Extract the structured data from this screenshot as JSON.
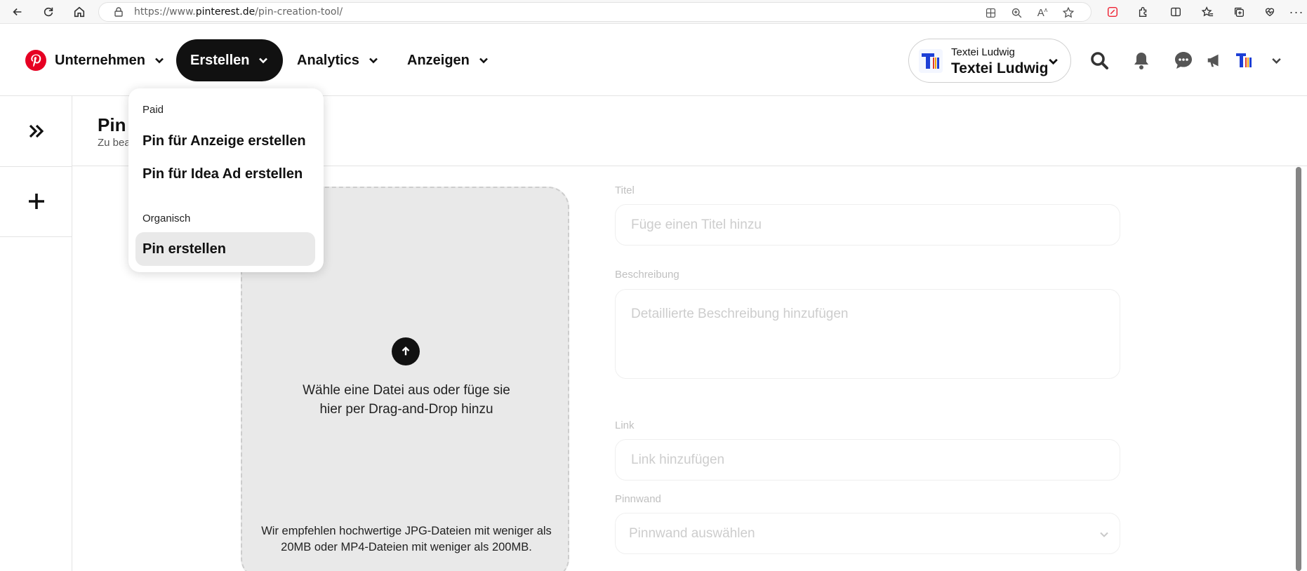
{
  "browser": {
    "url_prefix": "https://www.",
    "url_domain": "pinterest.de",
    "url_path": "/pin-creation-tool/"
  },
  "nav": {
    "business": "Unternehmen",
    "create": "Erstellen",
    "analytics": "Analytics",
    "ads": "Anzeigen"
  },
  "account": {
    "label_small": "Textei Ludwig",
    "label_big": "Textei Ludwig"
  },
  "dropdown": {
    "section_paid": "Paid",
    "item_ad_pin": "Pin für Anzeige erstellen",
    "item_idea_ad": "Pin für Idea Ad erstellen",
    "section_organic": "Organisch",
    "item_create_pin": "Pin erstellen"
  },
  "page": {
    "title": "Pin e",
    "subtitle": "Zu bea"
  },
  "upload": {
    "text": "Wähle eine Datei aus oder füge sie hier per Drag-and-Drop hinzu",
    "hint": "Wir empfehlen hochwertige JPG-Dateien mit weniger als 20MB oder MP4-Dateien mit weniger als 200MB."
  },
  "form": {
    "title_label": "Titel",
    "title_placeholder": "Füge einen Titel hinzu",
    "desc_label": "Beschreibung",
    "desc_placeholder": "Detaillierte Beschreibung hinzufügen",
    "link_label": "Link",
    "link_placeholder": "Link hinzufügen",
    "board_label": "Pinnwand",
    "board_placeholder": "Pinnwand auswählen"
  },
  "colors": {
    "pinterest_red": "#e60023",
    "active_nav_bg": "#111111",
    "upload_bg": "#e9e9e9"
  }
}
